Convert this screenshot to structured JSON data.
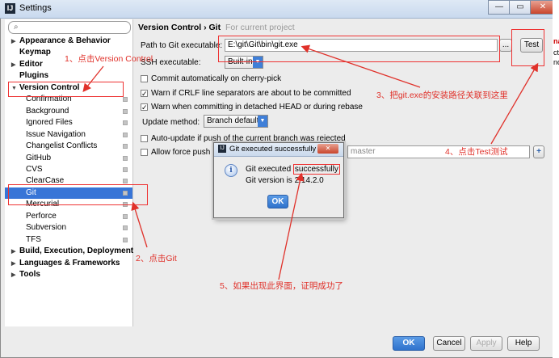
{
  "window": {
    "title": "Settings",
    "app_icon": "IJ",
    "controls": [
      "—",
      "▭",
      "✕"
    ]
  },
  "search": {
    "placeholder": ""
  },
  "tree": {
    "items": [
      {
        "label": "Appearance & Behavior",
        "bold": true,
        "arrow": "▶"
      },
      {
        "label": "Keymap",
        "bold": true
      },
      {
        "label": "Editor",
        "bold": true,
        "arrow": "▶"
      },
      {
        "label": "Plugins",
        "bold": true
      },
      {
        "label": "Version Control",
        "bold": true,
        "arrow": "▼"
      },
      {
        "label": "Confirmation"
      },
      {
        "label": "Background"
      },
      {
        "label": "Ignored Files"
      },
      {
        "label": "Issue Navigation"
      },
      {
        "label": "Changelist Conflicts"
      },
      {
        "label": "GitHub"
      },
      {
        "label": "CVS"
      },
      {
        "label": "ClearCase"
      },
      {
        "label": "Git",
        "selected": true
      },
      {
        "label": "Mercurial"
      },
      {
        "label": "Perforce"
      },
      {
        "label": "Subversion"
      },
      {
        "label": "TFS"
      },
      {
        "label": "Build, Execution, Deployment",
        "bold": true,
        "arrow": "▶"
      },
      {
        "label": "Languages & Frameworks",
        "bold": true,
        "arrow": "▶"
      },
      {
        "label": "Tools",
        "bold": true,
        "arrow": "▶"
      }
    ]
  },
  "main": {
    "breadcrumb": "Version Control › Git",
    "breadcrumb_sub": "For current project",
    "path_label": "Path to Git executable:",
    "path_value": "E:\\git\\Git\\bin\\git.exe",
    "browse_label": "...",
    "test_label": "Test",
    "ssh_label": "SSH executable:",
    "ssh_value": "Built-in",
    "cb_cherry": "Commit automatically on cherry-pick",
    "cb_crlf": "Warn if CRLF line separators are about to be committed",
    "cb_detached": "Warn when committing in detached HEAD or during rebase",
    "update_label": "Update method:",
    "update_value": "Branch default",
    "cb_autoupdate": "Auto-update if push of the current branch was rejected",
    "cb_force": "Allow force push",
    "branch_value": "master",
    "add_icon": "+"
  },
  "dialog": {
    "title": "Git executed successfully",
    "line1_prefix": "Git executed ",
    "line1_word": "successfully",
    "line2": "Git version is 2.14.2.0",
    "ok": "OK",
    "close": "✕"
  },
  "footer": {
    "ok": "OK",
    "cancel": "Cancel",
    "apply": "Apply",
    "help": "Help"
  },
  "annotations": {
    "a1": "1、点击Version Control",
    "a2": "2、点击Git",
    "a3": "3、把git.exe的安装路径关联到这里",
    "a4": "4、点击Test测试",
    "a5": "5、如果出现此界面，证明成功了"
  },
  "colors": {
    "accent": "#3875d7",
    "annotation_red": "#e0312a",
    "primary_button": "#2f72cc"
  },
  "right_sliver_text": [
    "na",
    "ct",
    "no"
  ]
}
